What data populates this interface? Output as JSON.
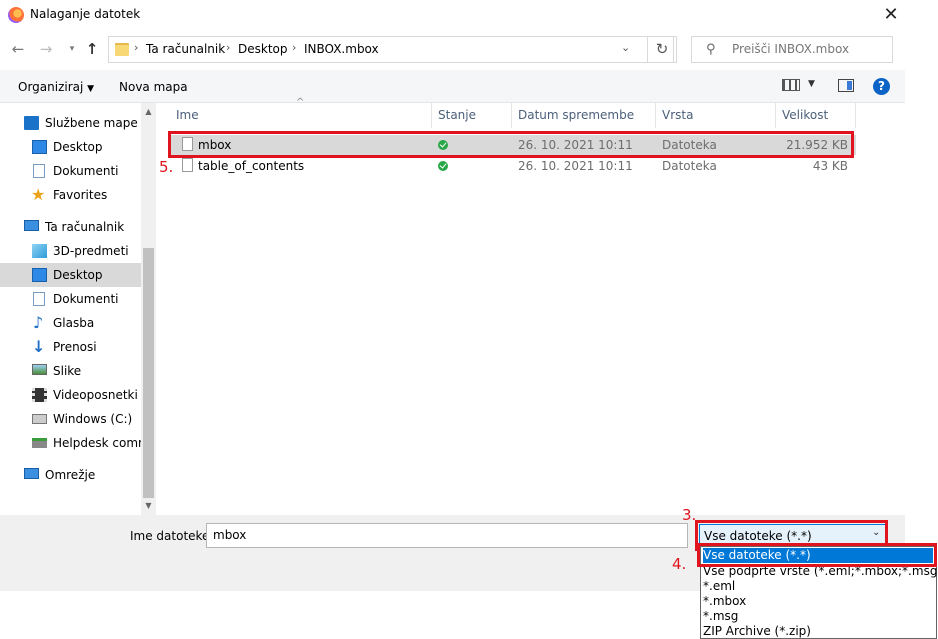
{
  "window": {
    "title": "Nalaganje datotek",
    "close": "✕"
  },
  "nav": {
    "breadcrumb": [
      "Ta računalnik",
      "Desktop",
      "INBOX.mbox"
    ],
    "search_placeholder": "Preišči INBOX.mbox"
  },
  "toolbar": {
    "organize": "Organiziraj",
    "new_folder": "Nova mapa"
  },
  "sidebar": {
    "items": [
      {
        "label": "Službene mape",
        "icon": "building-icon"
      },
      {
        "label": "Desktop",
        "icon": "desktop-icon"
      },
      {
        "label": "Dokumenti",
        "icon": "document-icon"
      },
      {
        "label": "Favorites",
        "icon": "star-icon"
      },
      {
        "label": "Ta računalnik",
        "icon": "computer-icon"
      },
      {
        "label": "3D-predmeti",
        "icon": "cube-icon"
      },
      {
        "label": "Desktop",
        "icon": "desktop-icon",
        "selected": true
      },
      {
        "label": "Dokumenti",
        "icon": "document-icon"
      },
      {
        "label": "Glasba",
        "icon": "music-icon"
      },
      {
        "label": "Prenosi",
        "icon": "download-icon"
      },
      {
        "label": "Slike",
        "icon": "picture-icon"
      },
      {
        "label": "Videoposnetki",
        "icon": "film-icon"
      },
      {
        "label": "Windows (C:)",
        "icon": "drive-icon"
      },
      {
        "label": "Helpdesk comm",
        "icon": "network-drive-icon"
      },
      {
        "label": "Omrežje",
        "icon": "network-icon"
      }
    ]
  },
  "columns": {
    "name": "Ime",
    "status": "Stanje",
    "date": "Datum spremembe",
    "type": "Vrsta",
    "size": "Velikost"
  },
  "files": [
    {
      "name": "mbox",
      "date": "26. 10. 2021 10:11",
      "type": "Datoteka",
      "size": "21.952 KB"
    },
    {
      "name": "table_of_contents",
      "date": "26. 10. 2021 10:11",
      "type": "Datoteka",
      "size": "43 KB"
    }
  ],
  "bottom": {
    "filename_label": "Ime datoteke:",
    "filename_value": "mbox",
    "filetype_selected": "Vse datoteke (*.*)",
    "filetype_options": [
      "Vse datoteke (*.*)",
      "Vse podprte vrste (*.eml;*.mbox;*.msg;*.zip)",
      "*.eml",
      "*.mbox",
      "*.msg",
      "ZIP Archive (*.zip)"
    ]
  },
  "annotations": {
    "step3": "3.",
    "step4": "4.",
    "step5": "5."
  },
  "colors": {
    "accent": "#0078d7",
    "highlight_red": "#e0141e",
    "sync_ok": "#27a745"
  }
}
